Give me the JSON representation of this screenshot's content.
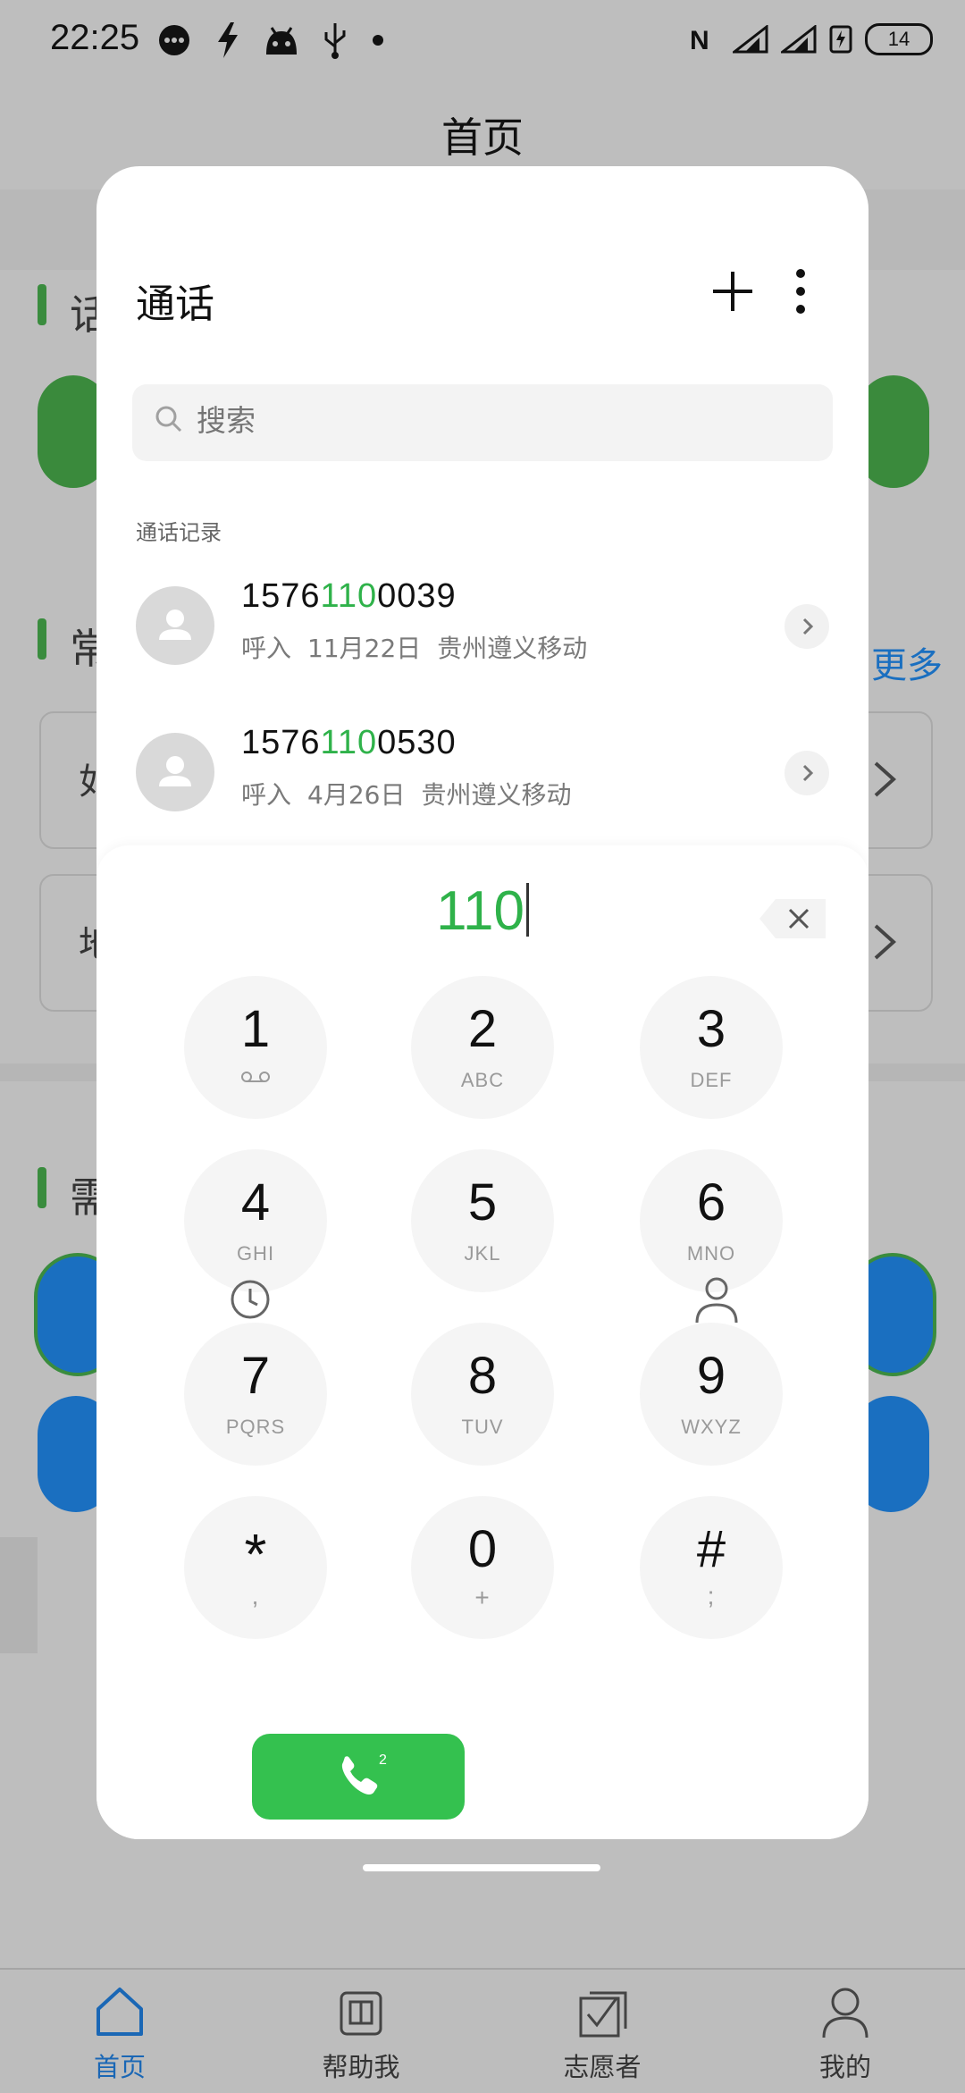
{
  "status_bar": {
    "time": "22:25",
    "battery": "14"
  },
  "background_app": {
    "page_title": "首页",
    "section_chars": [
      "话",
      "常",
      "需"
    ],
    "more_link": "更多",
    "card_chars": [
      "如",
      "地"
    ]
  },
  "bottom_nav": {
    "items": [
      {
        "label": "首页",
        "icon": "home-icon",
        "active": true
      },
      {
        "label": "帮助我",
        "icon": "book-icon",
        "active": false
      },
      {
        "label": "志愿者",
        "icon": "checkbox-icon",
        "active": false
      },
      {
        "label": "我的",
        "icon": "person-icon",
        "active": false
      }
    ]
  },
  "dialer_sheet": {
    "title": "通话",
    "search_placeholder": "搜索",
    "section_label": "通话记录",
    "call_log": [
      {
        "number_prefix": "1576",
        "number_match": "110",
        "number_suffix": "0039",
        "type": "呼入",
        "date": "11月22日",
        "location": "贵州遵义移动"
      },
      {
        "number_prefix": "1576",
        "number_match": "110",
        "number_suffix": "0530",
        "type": "呼入",
        "date": "4月26日",
        "location": "贵州遵义移动"
      }
    ],
    "input": "110",
    "keys": [
      {
        "digit": "1",
        "sub": ""
      },
      {
        "digit": "2",
        "sub": "ABC"
      },
      {
        "digit": "3",
        "sub": "DEF"
      },
      {
        "digit": "4",
        "sub": "GHI"
      },
      {
        "digit": "5",
        "sub": "JKL"
      },
      {
        "digit": "6",
        "sub": "MNO"
      },
      {
        "digit": "7",
        "sub": "PQRS"
      },
      {
        "digit": "8",
        "sub": "TUV"
      },
      {
        "digit": "9",
        "sub": "WXYZ"
      },
      {
        "digit": "*",
        "sub": ","
      },
      {
        "digit": "0",
        "sub": "+"
      },
      {
        "digit": "#",
        "sub": ";"
      }
    ],
    "call_sim_label": "2",
    "accent_color": "#34c14f"
  }
}
